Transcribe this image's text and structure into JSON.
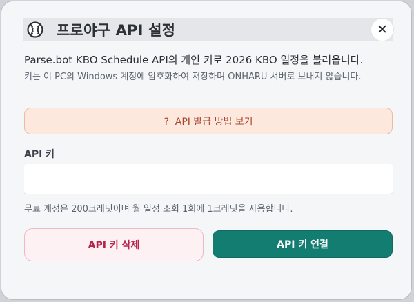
{
  "dialog": {
    "title": "프로야구 API 설정",
    "title_icon": "baseball-icon",
    "close_label": "✕",
    "description": "Parse.bot KBO Schedule API의 개인 키로 2026 KBO 일정을 불러옵니다.",
    "sub_description": "키는 이 PC의 Windows 계정에 암호화하여 저장하며 ONHARU 서버로 보내지 않습니다.",
    "guide_button_label": "?  API 발급 방법 보기",
    "api_key_label": "API 키",
    "api_key_value": "",
    "api_key_placeholder": "",
    "hint": "무료 계정은 200크레딧이며 월 일정 조회 1회에 1크레딧을 사용합니다.",
    "delete_button_label": "API 키 삭제",
    "connect_button_label": "API 키 연결"
  },
  "colors": {
    "accent": "#147d72",
    "danger": "#b4244a",
    "guide": "#a8432a"
  }
}
